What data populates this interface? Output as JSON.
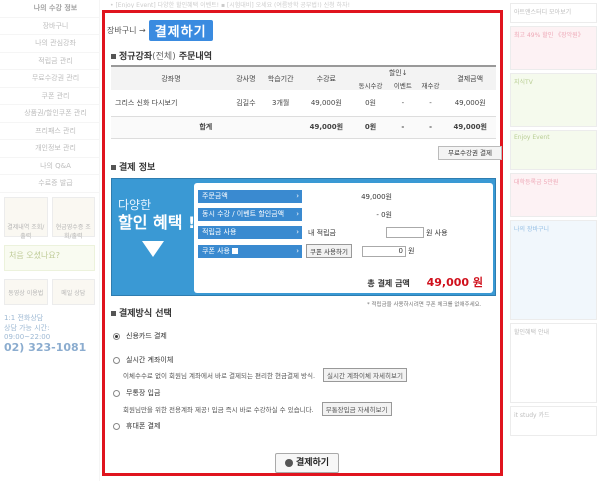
{
  "top_strip": "• [Enjoy Event] 다양한 할인혜택 이벤트!   ▪ [시험대비] 오세요 (여름방학 공부법!) 신청 하자!",
  "left_nav": {
    "items": [
      "나의 수강 정보",
      "장바구니",
      "나의 관심강좌",
      "적립금 관리",
      "무료수강권 관리",
      "쿠폰 관리",
      "상품권/할인쿠폰 관리",
      "프리패스 관리",
      "개인정보 관리",
      "나의 Q&A",
      "수료증 발급"
    ],
    "tiles": [
      {
        "label": "결제내역 조회/출력"
      },
      {
        "label": "현금영수증 조회/출력"
      }
    ],
    "promo": "처음 오셨나요?",
    "tiles2": [
      {
        "label": "동영상 이용법"
      },
      {
        "label": "메일 상담"
      }
    ],
    "phone_title": "1:1 전화상담",
    "phone_hours": "상담 가능 시간: 09:00~22:00",
    "phone_number": "02) 323-1081"
  },
  "right_sidebar": {
    "boxes": [
      "아트앤스터디 모아보기",
      "최고 49% 할인 《장악원》",
      "지식TV",
      "Enjoy Event",
      "대학등록금 5만원",
      "나의 장바구니",
      "할인혜택 안내",
      "it study 카드"
    ]
  },
  "modal": {
    "breadcrumb_prev": "장바구니 →",
    "breadcrumb_current": "결제하기",
    "orders_title": "정규강좌",
    "orders_title_sub": "(전체)",
    "orders_title_tail": " 주문내역",
    "columns": {
      "course": "강좌명",
      "lecturer": "강사명",
      "period": "학습기간",
      "price": "수강료",
      "discount": "할인↓",
      "disc_course": "동시수강",
      "disc_event": "이벤트",
      "disc_resub": "재수강",
      "amount": "결제금액"
    },
    "rows": [
      {
        "course": "그리스 신화 다시보기",
        "lecturer": "김길수",
        "period": "3개월",
        "price": "49,000원",
        "disc_course": "0원",
        "disc_event": "-",
        "disc_resub": "-",
        "amount": "49,000원"
      }
    ],
    "total": {
      "label": "합계",
      "price": "49,000원",
      "disc_course": "0원",
      "disc_event": "-",
      "disc_resub": "-",
      "amount": "49,000원"
    },
    "free_voucher_button": "무료수강권 결제",
    "payment_info_title": "결제 정보",
    "ad_line1": "다양한",
    "ad_line2": "할인 혜택 !",
    "info": {
      "order_amount_label": "주문금액",
      "order_amount": "49,000원",
      "concurrent_label": "동시 수강 / 이벤트 할인금액",
      "concurrent_amount": "- 0원",
      "points_label": "적립금 사용",
      "points_text": "내 적립금",
      "points_suffix": "원 사용",
      "points_value": "",
      "coupon_label": "쿠폰 사용",
      "coupon_button": "쿠폰 사용하기",
      "coupon_value": "0",
      "coupon_suffix": "원",
      "total_label": "총 결제 금액",
      "total_amount": "49,000 원"
    },
    "note": "* 적립금을 사용하시려면 쿠폰 체크를 없애주세요.",
    "method_title": "결제방식 선택",
    "methods": {
      "card": "신용카드 결제",
      "realtime": "실시간 계좌이체",
      "realtime_desc": "이체수수료 없이 회원님 계좌에서 바로 결제되는 편리한 현금결제 방식.",
      "realtime_btn": "실시간 계좌이체 자세히보기",
      "deposit": "무통장 입금",
      "deposit_desc": "회원님만을 위한 전용계좌 제공! 입금 즉시 바로 수강하실 수 있습니다.",
      "deposit_btn": "무통장입금 자세히보기",
      "phone": "휴대폰 결제"
    },
    "pay_button": "결제하기"
  }
}
